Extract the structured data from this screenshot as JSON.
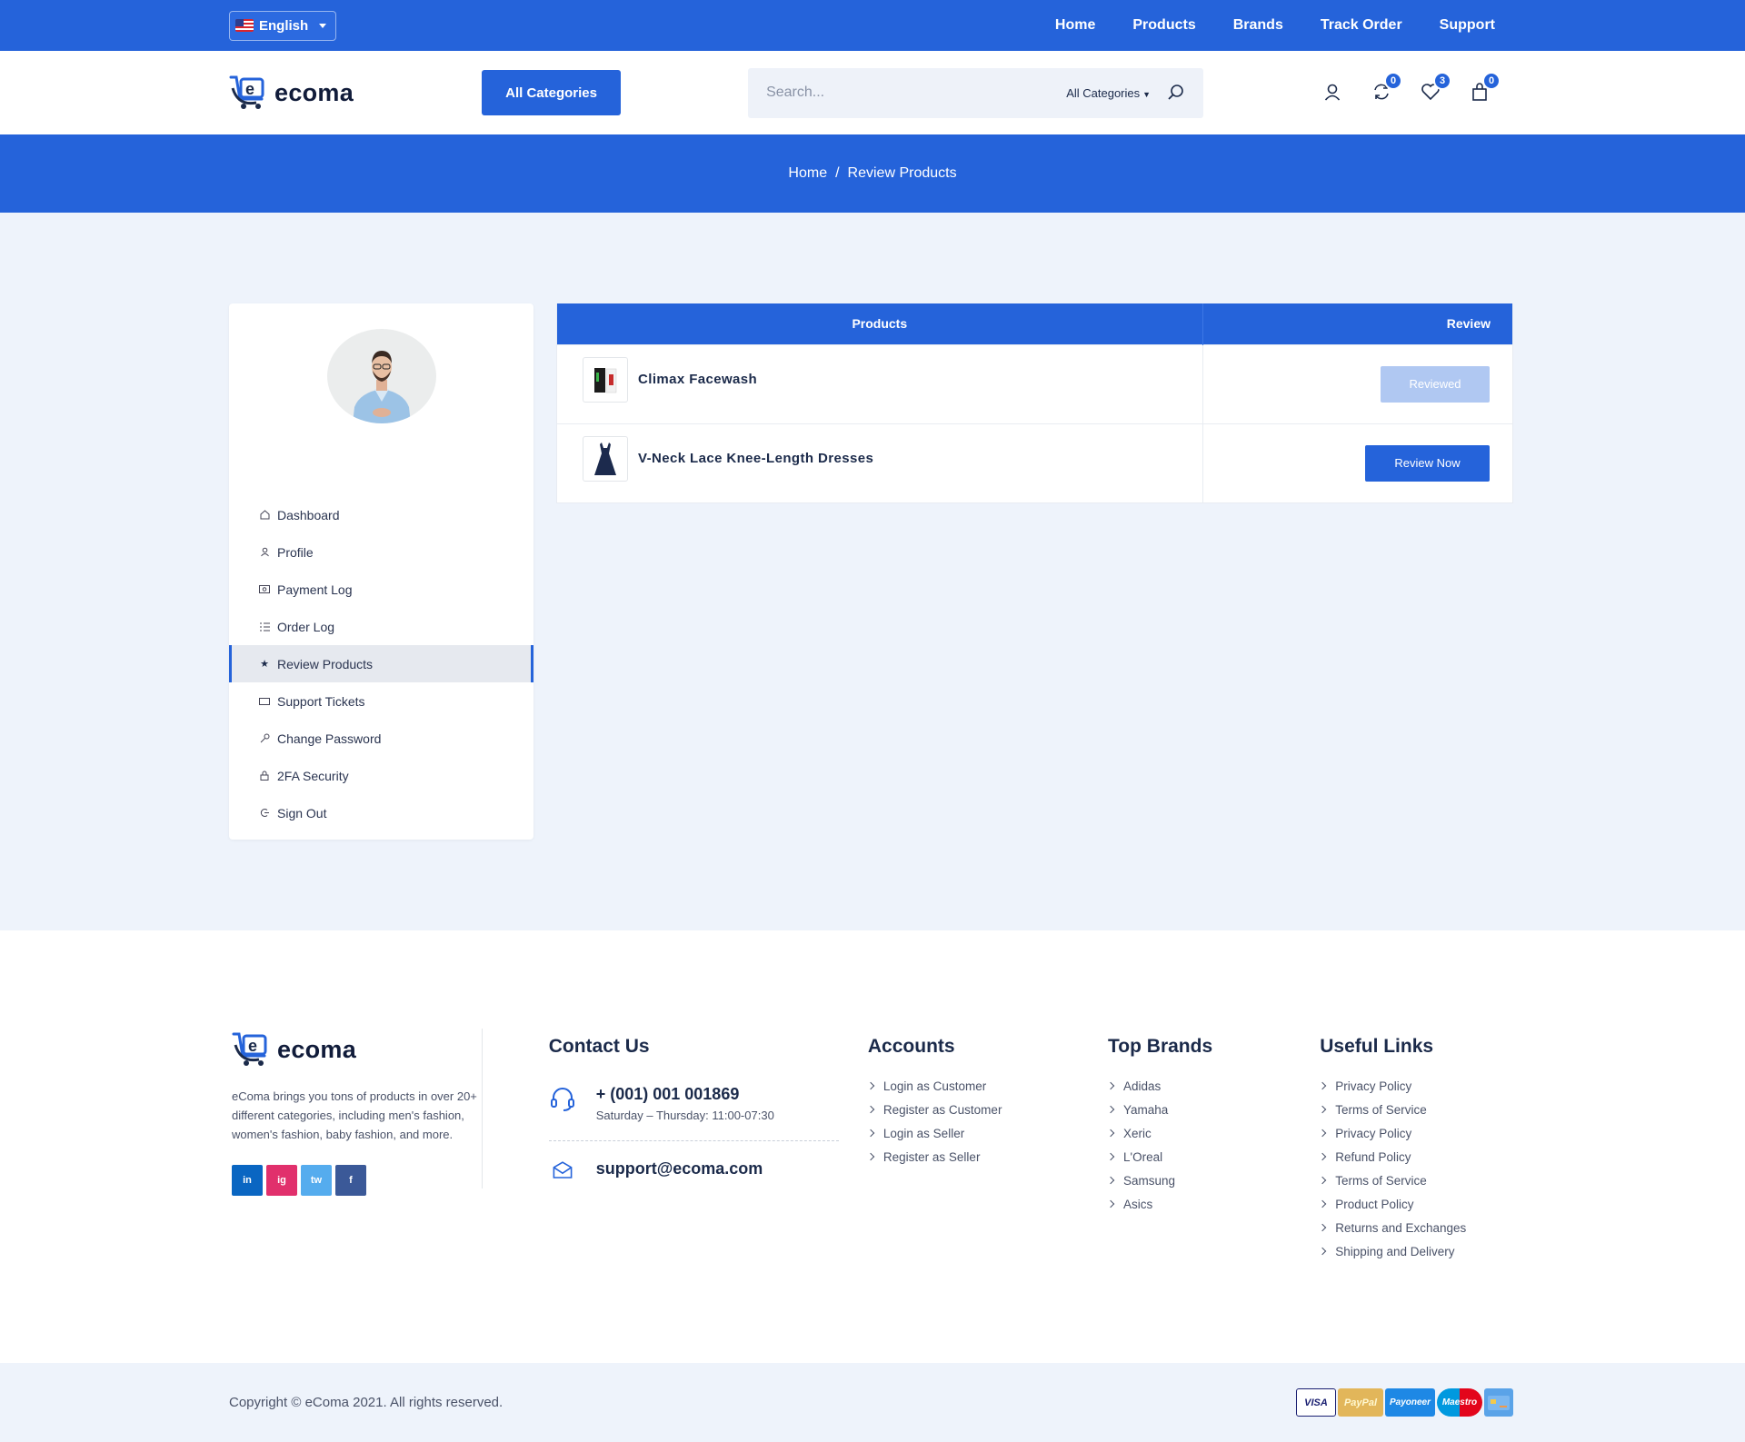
{
  "topbar": {
    "language": "English",
    "nav": [
      "Home",
      "Products",
      "Brands",
      "Track Order",
      "Support"
    ]
  },
  "header": {
    "logo_text": "ecoma",
    "categories_button": "All Categories",
    "search_placeholder": "Search...",
    "search_category": "All Categories",
    "compare_count": "0",
    "wishlist_count": "3",
    "cart_count": "0"
  },
  "breadcrumb": {
    "home": "Home",
    "separator": "/",
    "current": "Review Products"
  },
  "sidebar": {
    "items": [
      {
        "label": "Dashboard",
        "icon": "home-icon"
      },
      {
        "label": "Profile",
        "icon": "user-icon"
      },
      {
        "label": "Payment Log",
        "icon": "money-icon"
      },
      {
        "label": "Order Log",
        "icon": "list-icon"
      },
      {
        "label": "Review Products",
        "icon": "star-icon",
        "active": true
      },
      {
        "label": "Support Tickets",
        "icon": "ticket-icon"
      },
      {
        "label": "Change Password",
        "icon": "key-icon"
      },
      {
        "label": "2FA Security",
        "icon": "lock-icon"
      },
      {
        "label": "Sign Out",
        "icon": "signout-icon"
      }
    ]
  },
  "table": {
    "headers": {
      "products": "Products",
      "review": "Review"
    },
    "rows": [
      {
        "name": "Climax Facewash",
        "action": "Reviewed",
        "state": "reviewed"
      },
      {
        "name": "V-Neck Lace Knee-Length Dresses",
        "action": "Review Now",
        "state": "pending"
      }
    ]
  },
  "footer": {
    "logo_text": "ecoma",
    "about": "eComa brings you tons of products in over 20+ different categories, including men's fashion, women's fashion, baby fashion, and more.",
    "socials": [
      "in",
      "ig",
      "tw",
      "f"
    ],
    "contact": {
      "title": "Contact Us",
      "phone": "+ (001) 001 001869",
      "hours": "Saturday – Thursday: 11:00-07:30",
      "email": "support@ecoma.com"
    },
    "accounts": {
      "title": "Accounts",
      "links": [
        "Login as Customer",
        "Register as Customer",
        "Login as Seller",
        "Register as Seller"
      ]
    },
    "brands": {
      "title": "Top Brands",
      "links": [
        "Adidas",
        "Yamaha",
        "Xeric",
        "L'Oreal",
        "Samsung",
        "Asics"
      ]
    },
    "useful": {
      "title": "Useful Links",
      "links": [
        "Privacy Policy",
        "Terms of Service",
        "Privacy Policy",
        "Refund Policy",
        "Terms of Service",
        "Product Policy",
        "Returns and Exchanges",
        "Shipping and Delivery"
      ]
    }
  },
  "bottom": {
    "copyright": "Copyright © eComa 2021. All rights reserved.",
    "payments": [
      "VISA",
      "PayPal",
      "Payoneer",
      "Maestro",
      "card"
    ]
  },
  "colors": {
    "primary": "#2563da",
    "bg_light": "#eef3fb"
  }
}
